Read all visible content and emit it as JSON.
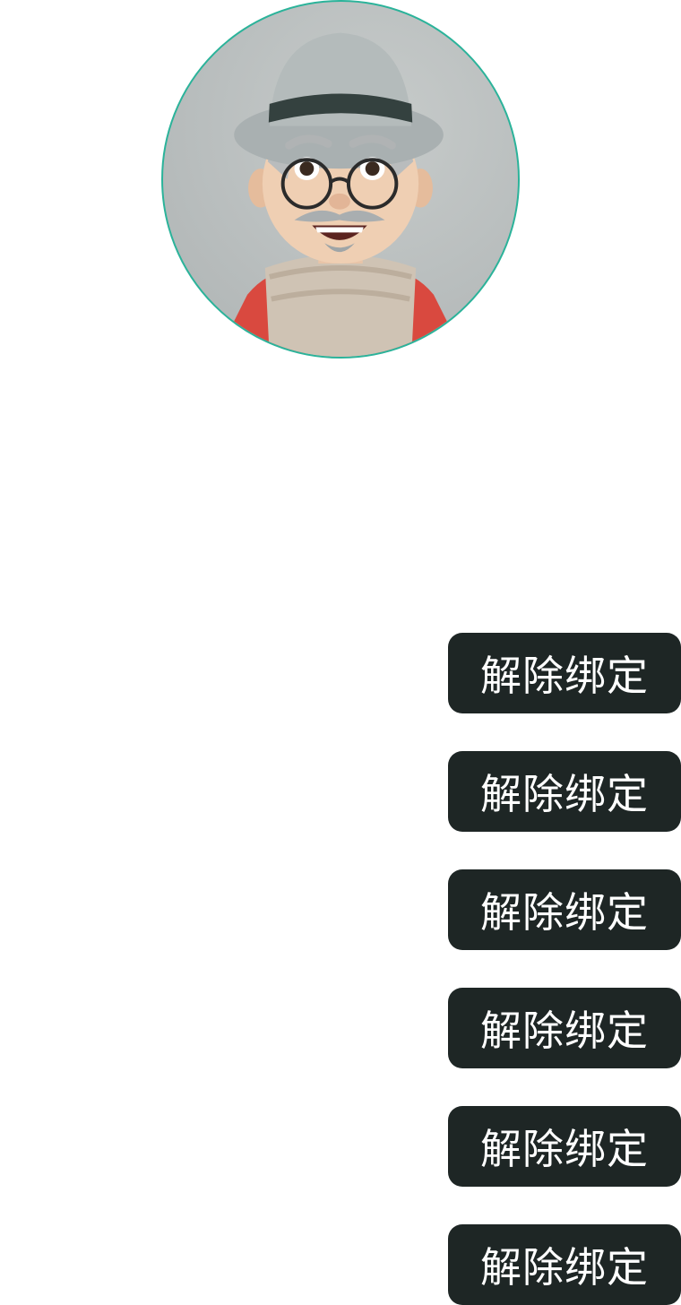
{
  "avatar": {
    "alt": "memoji-avatar",
    "ring_color": "#2bb39a"
  },
  "buttons": [
    {
      "label": "解除绑定"
    },
    {
      "label": "解除绑定"
    },
    {
      "label": "解除绑定"
    },
    {
      "label": "解除绑定"
    },
    {
      "label": "解除绑定"
    },
    {
      "label": "解除绑定"
    }
  ],
  "colors": {
    "button_bg": "#1e2625",
    "button_text": "#ffffff",
    "page_bg": "#ffffff"
  }
}
